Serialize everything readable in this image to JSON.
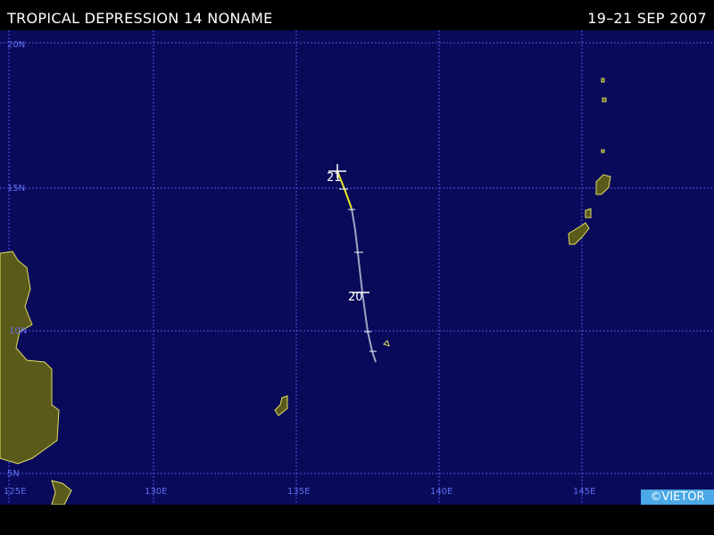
{
  "header": {
    "title": "TROPICAL DEPRESSION 14 NONAME",
    "dates": "19–21 SEP 2007"
  },
  "map": {
    "lat_labels": [
      "20N",
      "15N",
      "10N",
      "5N"
    ],
    "lon_labels": [
      "125E",
      "130E",
      "135E",
      "140E",
      "145E"
    ],
    "day_labels": [
      "21",
      "20"
    ],
    "track_colors": {
      "depression": "#9aa6c0",
      "storm": "#e8e820"
    },
    "ocean_color": "#0a0a5a",
    "land_color": "#5a5a1a",
    "coast_color": "#e0e060"
  },
  "credit": "©VIETOR"
}
